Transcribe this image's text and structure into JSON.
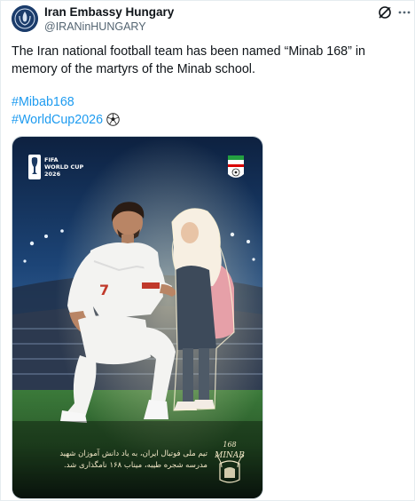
{
  "post": {
    "author": {
      "display_name": "Iran Embassy Hungary",
      "handle": "@IRANinHUNGARY",
      "avatar_icon": "embassy-emblem-icon"
    },
    "actions": {
      "grok_icon": "grok-icon",
      "more_icon": "more-options-icon"
    },
    "text": "The Iran national football team has been named “Minab 168” in memory of the martyrs of the Minab school.",
    "hashtags": [
      "#Mibab168",
      "#WorldCup2026"
    ],
    "hashtag_emoji": "soccer-ball-icon",
    "link_color": "#1d9bf0"
  },
  "media": {
    "fifa_logo": {
      "text": "FIFA\nWORLD CUP\n2026"
    },
    "federation_logo_icon": "iran-football-federation-icon",
    "persian_caption": [
      "تیم ملی فوتبال ایران، به یاد دانش آموزان شهید",
      "مدرسه شجره طیبه، میناب ۱۶۸ نامگذاری شد."
    ],
    "minab_logo": {
      "number": "168",
      "word": "MINAB"
    },
    "player_number": "7"
  }
}
